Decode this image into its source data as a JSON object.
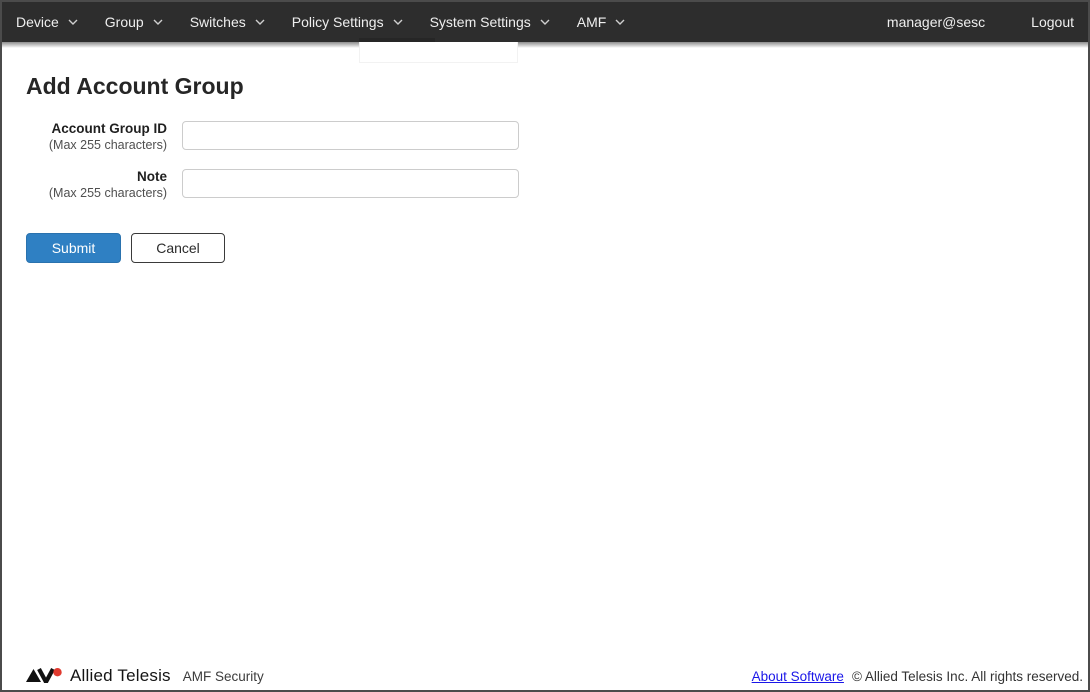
{
  "nav": {
    "items": [
      {
        "label": "Device"
      },
      {
        "label": "Group"
      },
      {
        "label": "Switches"
      },
      {
        "label": "Policy Settings"
      },
      {
        "label": "System Settings"
      },
      {
        "label": "AMF"
      }
    ],
    "user": "manager@sesc",
    "logout_label": "Logout"
  },
  "page": {
    "title": "Add Account Group",
    "form": {
      "fields": [
        {
          "label": "Account Group ID",
          "hint": "(Max 255 characters)",
          "value": ""
        },
        {
          "label": "Note",
          "hint": "(Max 255 characters)",
          "value": ""
        }
      ],
      "submit_label": "Submit",
      "cancel_label": "Cancel"
    }
  },
  "footer": {
    "brand": "Allied Telesis",
    "product": "AMF Security",
    "about_link": "About Software",
    "copyright": "© Allied Telesis Inc. All rights reserved."
  },
  "colors": {
    "nav_bg": "#2d2d2d",
    "accent_blue": "#2f80c3",
    "link_blue": "#1a16e8",
    "logo_red": "#e03a2f",
    "input_border": "#cccccc"
  }
}
